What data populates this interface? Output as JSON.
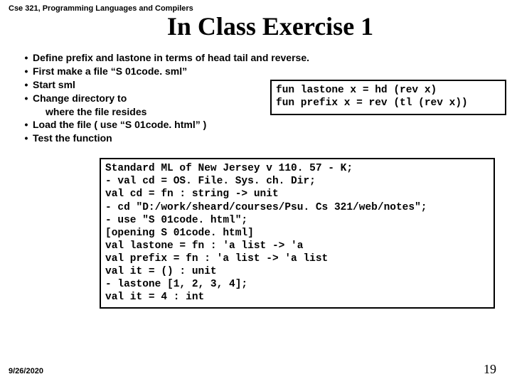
{
  "header": "Cse 321, Programming Languages and Compilers",
  "title": "In Class Exercise 1",
  "bullets": [
    "Define prefix and lastone in terms of head tail and reverse.",
    "First make a file “S 01code. sml”",
    "Start sml",
    "Change directory to",
    "INDENT:where the file resides",
    "Load the file ( use “S 01code. html” )",
    "Test the function"
  ],
  "code1": "fun lastone x = hd (rev x)\nfun prefix x = rev (tl (rev x))",
  "code2": "Standard ML of New Jersey v 110. 57 - K;\n- val cd = OS. File. Sys. ch. Dir;\nval cd = fn : string -> unit\n- cd \"D:/work/sheard/courses/Psu. Cs 321/web/notes\";\n- use \"S 01code. html\";\n[opening S 01code. html]\nval lastone = fn : 'a list -> 'a\nval prefix = fn : 'a list -> 'a list\nval it = () : unit\n- lastone [1, 2, 3, 4];\nval it = 4 : int",
  "footer": {
    "date": "9/26/2020",
    "page": "19"
  }
}
